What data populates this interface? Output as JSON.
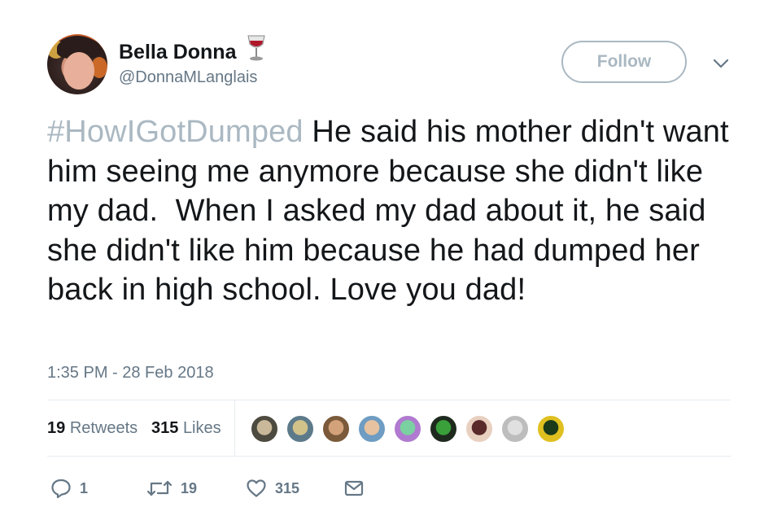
{
  "user": {
    "display_name": "Bella Donna",
    "handle": "@DonnaMLanglais",
    "name_emoji": "wine-glass-icon"
  },
  "header": {
    "follow_label": "Follow",
    "menu_icon": "chevron-down-icon"
  },
  "tweet": {
    "hashtag": "#HowIGotDumped",
    "text": " He said his mother didn't want him seeing me anymore because she didn't like my dad.  When I asked my dad about it, he said she didn't like him because he had dumped her back in high school. Love you dad!",
    "timestamp": "1:35 PM - 28 Feb 2018"
  },
  "stats": {
    "retweets_count": "19",
    "retweets_label": "Retweets",
    "likes_count": "315",
    "likes_label": "Likes"
  },
  "actions": {
    "reply_count": "1",
    "retweet_count": "19",
    "like_count": "315"
  },
  "colors": {
    "hashtag": "#aab8c2",
    "muted": "#657786",
    "text": "#14171a",
    "border": "#e6ecf0"
  },
  "liker_avatars": [
    {
      "name": "liker-avatar-1",
      "bg": "#4d4a3f",
      "fg": "#c9b99a"
    },
    {
      "name": "liker-avatar-2",
      "bg": "#5c7a8a",
      "fg": "#d1c28a"
    },
    {
      "name": "liker-avatar-3",
      "bg": "#7a5a3a",
      "fg": "#d4a27a"
    },
    {
      "name": "liker-avatar-4",
      "bg": "#6e9cc2",
      "fg": "#e6c2a0"
    },
    {
      "name": "liker-avatar-5",
      "bg": "#b07ad0",
      "fg": "#7ad0a0"
    },
    {
      "name": "liker-avatar-6",
      "bg": "#1f2a1f",
      "fg": "#3aa03a"
    },
    {
      "name": "liker-avatar-7",
      "bg": "#e8d0c0",
      "fg": "#5a2a2a"
    },
    {
      "name": "liker-avatar-8",
      "bg": "#bdbdbd",
      "fg": "#e0e0e0"
    },
    {
      "name": "liker-avatar-9",
      "bg": "#e0c020",
      "fg": "#1a3a1a"
    }
  ]
}
